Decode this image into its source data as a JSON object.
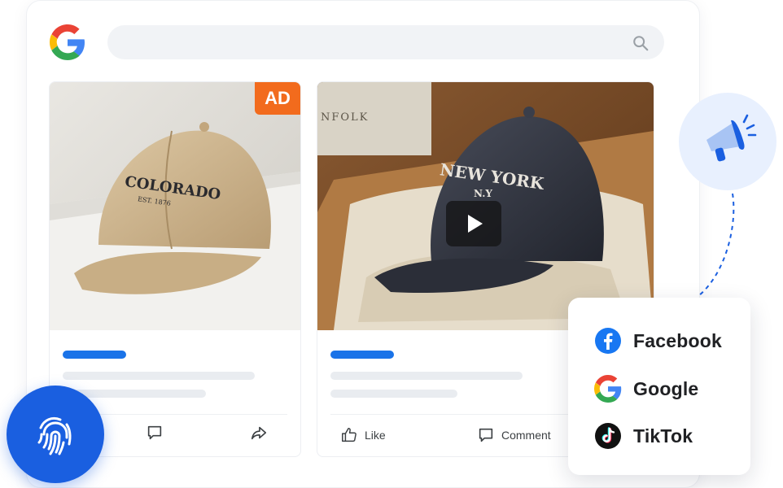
{
  "search": {
    "placeholder": ""
  },
  "ad_card": {
    "badge": "AD",
    "cap_text": "COLORADO",
    "cap_subtext": "EST. 1876"
  },
  "video_card": {
    "cap_text": "NEW YORK",
    "cap_subtext": "N.Y",
    "box_text": "NFOLK",
    "like_label": "Like",
    "comment_label": "Comment"
  },
  "platforms": [
    {
      "name": "Facebook",
      "icon": "facebook-icon"
    },
    {
      "name": "Google",
      "icon": "google-icon"
    },
    {
      "name": "TikTok",
      "icon": "tiktok-icon"
    }
  ],
  "colors": {
    "google_blue": "#4285F4",
    "google_red": "#EA4335",
    "google_yellow": "#FBBC05",
    "google_green": "#34A853",
    "accent_blue": "#1a73e8",
    "ad_orange": "#f26b1d",
    "facebook_blue": "#1877F2"
  }
}
